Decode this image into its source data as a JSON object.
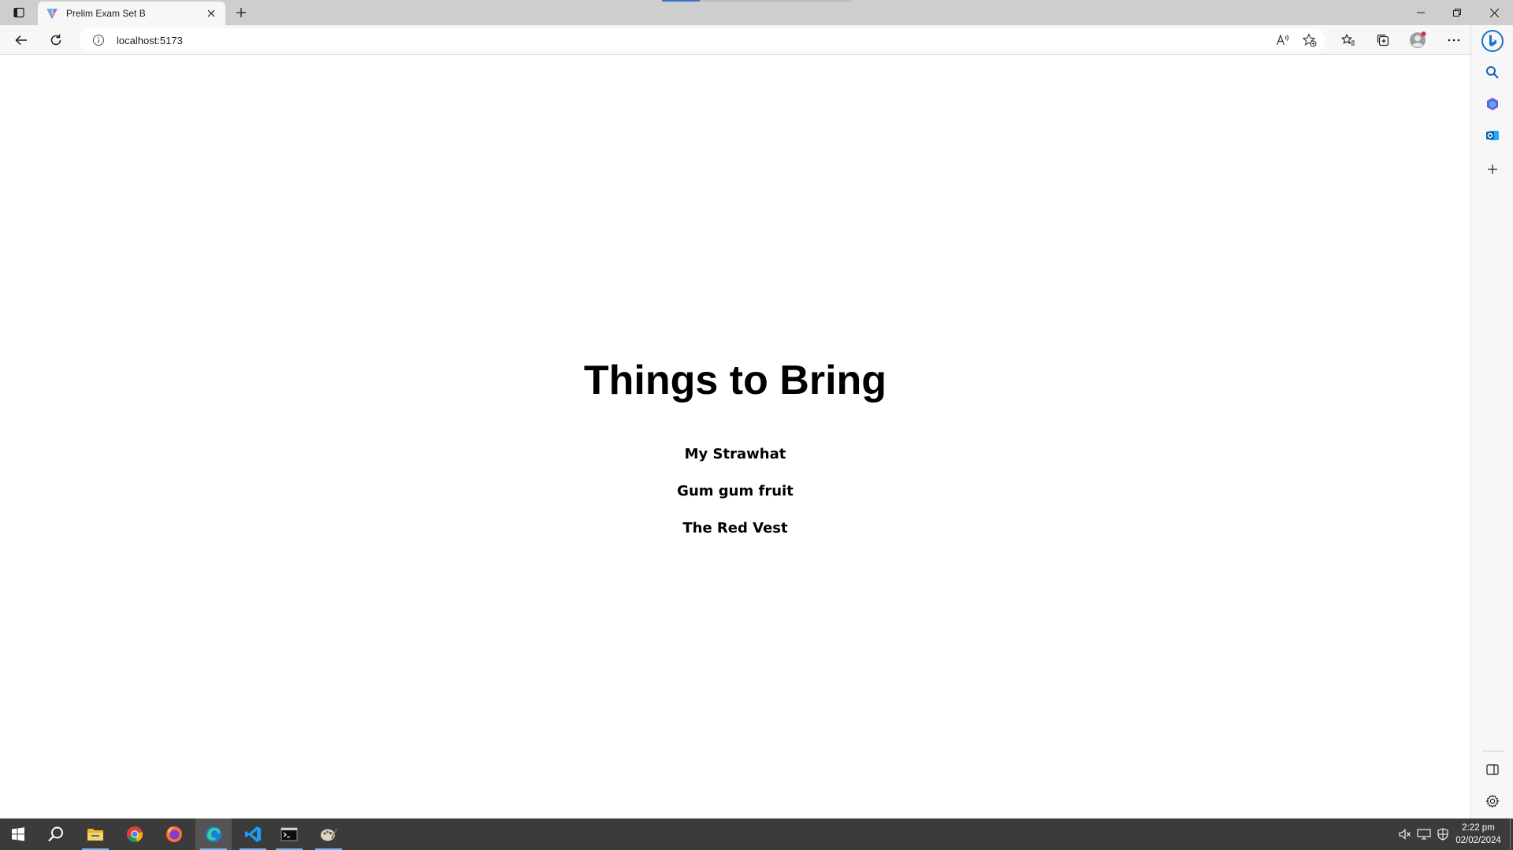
{
  "browser": {
    "tab": {
      "title": "Prelim Exam Set B",
      "favicon": "vite-logo-icon"
    },
    "address": {
      "url": "localhost:5173",
      "site_info_icon": "info-icon"
    },
    "toolbar_icons": [
      "back-icon",
      "refresh-icon",
      "read-aloud-icon",
      "add-favorite-icon",
      "favorites-icon",
      "collections-icon",
      "profile-icon",
      "more-icon"
    ],
    "sidebar_icons": [
      "bing-icon",
      "search-icon",
      "tools-icon",
      "outlook-icon",
      "add-icon",
      "hide-sidebar-icon",
      "settings-icon"
    ],
    "colors": {
      "tabstrip": "#cecece",
      "toolbar": "#f7f7f7",
      "loading_progress": "#3a76c4",
      "profile_notification": "#d13438"
    }
  },
  "page": {
    "heading": "Things to Bring",
    "items": [
      "My Strawhat",
      "Gum gum fruit",
      "The Red Vest"
    ]
  },
  "taskbar": {
    "apps": [
      "windows-start-icon",
      "search-icon",
      "file-explorer-icon",
      "chrome-icon",
      "firefox-icon",
      "edge-icon",
      "vscode-icon",
      "terminal-icon",
      "paint-icon"
    ],
    "active_app": "edge-icon",
    "clock": {
      "time": "2:22 pm",
      "date": "02/02/2024"
    },
    "colors": {
      "background": "#3b3b3b",
      "active_indicator": "#77b4f0"
    }
  }
}
